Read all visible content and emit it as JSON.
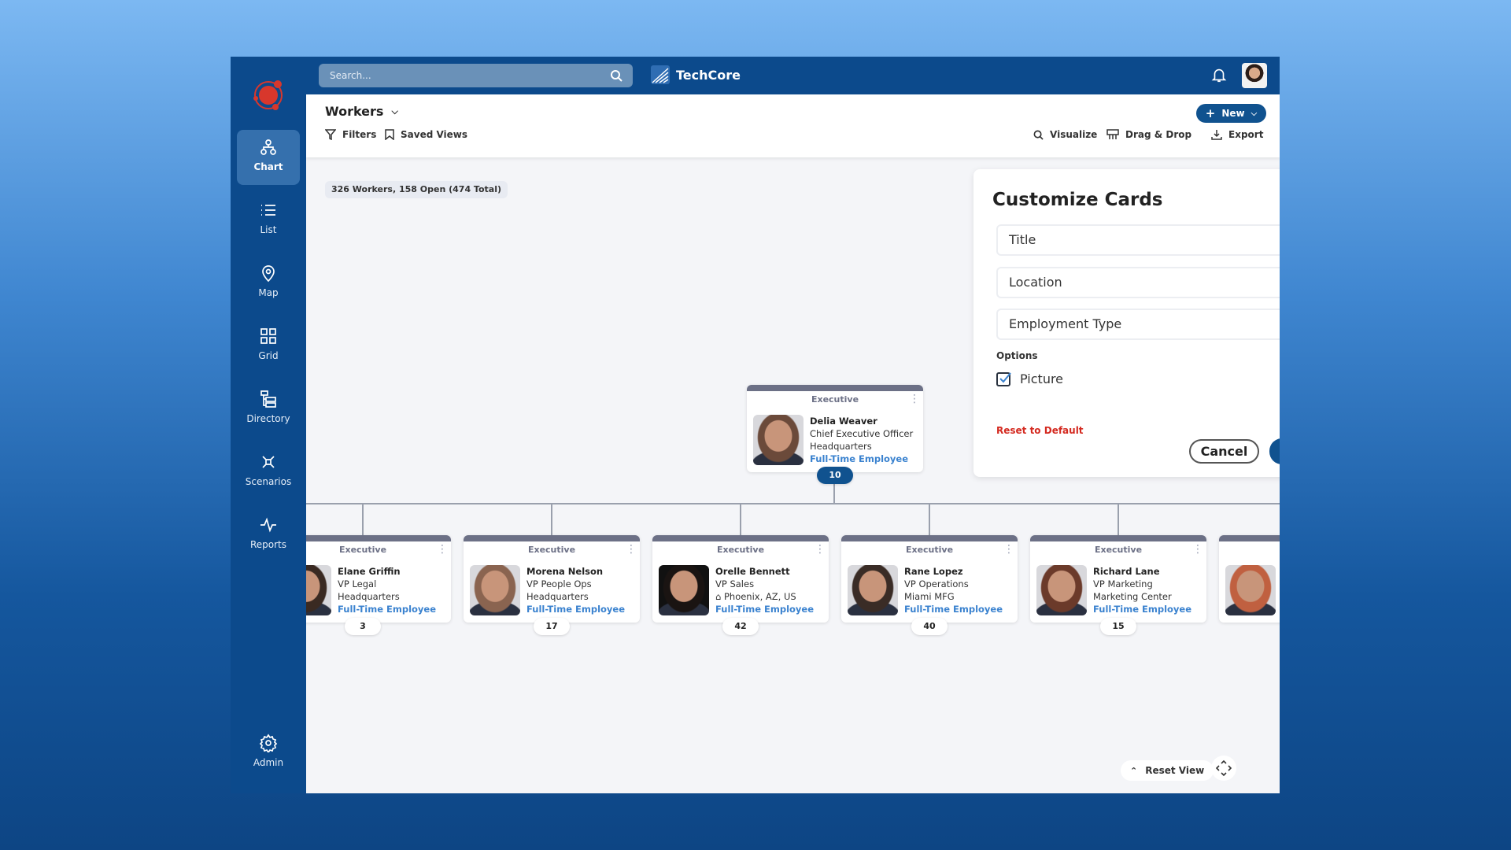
{
  "sidebar": {
    "items": [
      {
        "label": "Chart",
        "icon": "org-chart-icon",
        "active": true
      },
      {
        "label": "List",
        "icon": "list-icon"
      },
      {
        "label": "Map",
        "icon": "map-pin-icon"
      },
      {
        "label": "Grid",
        "icon": "grid-icon"
      },
      {
        "label": "Directory",
        "icon": "directory-icon"
      },
      {
        "label": "Scenarios",
        "icon": "scenarios-icon"
      },
      {
        "label": "Reports",
        "icon": "pulse-icon"
      }
    ],
    "admin": {
      "label": "Admin",
      "icon": "gear-icon"
    }
  },
  "topbar": {
    "search_placeholder": "Search...",
    "brand": "TechCore"
  },
  "subheader": {
    "view": "Workers",
    "filters": "Filters",
    "saved_views": "Saved Views",
    "visualize": "Visualize",
    "drag_drop": "Drag & Drop",
    "export": "Export",
    "new": "New"
  },
  "summary": "326 Workers, 158 Open (474 Total)",
  "root": {
    "dept": "Executive",
    "name": "Delia Weaver",
    "title": "Chief Executive Officer",
    "location": "Headquarters",
    "type": "Full-Time Employee",
    "count": "10"
  },
  "children": [
    {
      "dept": "Executive",
      "name": "Elane Griffin",
      "title": "VP Legal",
      "location": "Headquarters",
      "type": "Full-Time Employee",
      "count": "3"
    },
    {
      "dept": "Executive",
      "name": "Morena Nelson",
      "title": "VP People Ops",
      "location": "Headquarters",
      "type": "Full-Time Employee",
      "count": "17"
    },
    {
      "dept": "Executive",
      "name": "Orelle Bennett",
      "title": "VP Sales",
      "location": "Phoenix, AZ, US",
      "remote": true,
      "type": "Full-Time Employee",
      "count": "42"
    },
    {
      "dept": "Executive",
      "name": "Rane Lopez",
      "title": "VP Operations",
      "location": "Miami MFG",
      "type": "Full-Time Employee",
      "count": "40"
    },
    {
      "dept": "Executive",
      "name": "Richard Lane",
      "title": "VP Marketing",
      "location": "Marketing Center",
      "type": "Full-Time Employee",
      "count": "15"
    },
    {
      "dept": "",
      "name": "",
      "title": "",
      "location": "",
      "type": "",
      "count": ""
    }
  ],
  "panel": {
    "title": "Customize Cards",
    "fields": [
      "Title",
      "Location",
      "Employment Type"
    ],
    "options_label": "Options",
    "picture_label": "Picture",
    "picture_checked": true,
    "reset": "Reset to Default",
    "cancel": "Cancel"
  },
  "controls": {
    "reset_view": "Reset View"
  },
  "colors": {
    "primary": "#10528f",
    "accent_red": "#d42a20",
    "link": "#3a82cf"
  }
}
